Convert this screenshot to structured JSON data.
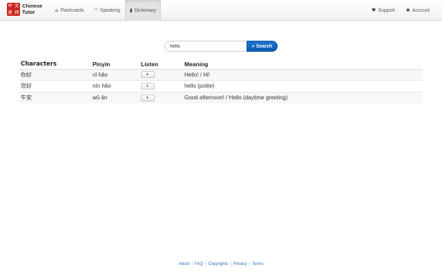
{
  "brand": {
    "logo_chars": [
      "中",
      "文",
      "老",
      "师"
    ],
    "line1": "Chinese",
    "line2": "Tutor",
    "logo_color": "#c8251c"
  },
  "nav": {
    "items": [
      {
        "label": "Flashcards",
        "icon": "home-icon",
        "glyph": "⌂"
      },
      {
        "label": "Speaking",
        "icon": "microphone-icon",
        "glyph": "◠"
      },
      {
        "label": "Dictionary",
        "icon": "book-icon",
        "glyph": "▮",
        "active": true
      }
    ],
    "right": [
      {
        "label": "Support",
        "icon": "heart-icon",
        "glyph": "♥"
      },
      {
        "label": "Account",
        "icon": "gear-icon",
        "glyph": "✱"
      }
    ]
  },
  "search": {
    "value": "hello",
    "button_label": "Search",
    "button_icon": "search-icon",
    "accent": "#1a73cc"
  },
  "table": {
    "headers": [
      "Characters",
      "Pinyin",
      "Listen",
      "Meaning"
    ],
    "rows": [
      {
        "characters": "你好",
        "pinyin": "nǐ hǎo",
        "meaning": "Hello! / Hi!"
      },
      {
        "characters": "您好",
        "pinyin": "nín hǎo",
        "meaning": "hello (polite)"
      },
      {
        "characters": "午安",
        "pinyin": "wǔ ān",
        "meaning": "Good afternoon! / Hello (daytime greeting)"
      }
    ],
    "listen_icon": "speaker-icon"
  },
  "footer": {
    "links": [
      "About",
      "FAQ",
      "Copyrights",
      "Privacy",
      "Terms"
    ],
    "separator": "|"
  }
}
